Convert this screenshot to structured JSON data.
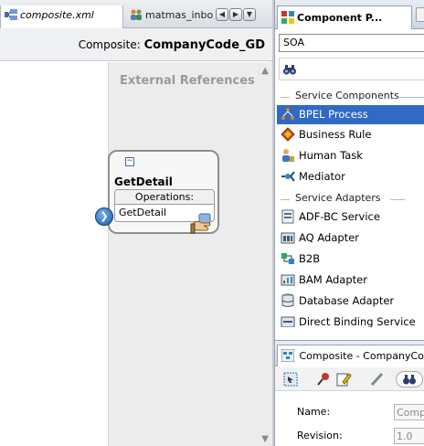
{
  "editor": {
    "tabs": [
      {
        "label": "composite.xml",
        "icon": "composite-icon"
      },
      {
        "label": "matmas_inbou",
        "icon": "mediator-people-icon"
      }
    ],
    "nav_buttons": [
      "◀",
      "▶",
      "▼"
    ],
    "composite_prefix": "Composite:",
    "composite_name": "CompanyCode_GD",
    "external_references_title": "External References",
    "service": {
      "name": "GetDetail",
      "operations_header": "Operations:",
      "operations": [
        "GetDetail"
      ],
      "collapse_symbol": "−",
      "arrow_symbol": "❯"
    }
  },
  "palette": {
    "title": "Component P...",
    "selected_category": "SOA",
    "groups": [
      {
        "label": "Service Components",
        "items": [
          {
            "label": "BPEL Process",
            "icon": "bpel-icon",
            "selected": true
          },
          {
            "label": "Business Rule",
            "icon": "business-rule-icon",
            "selected": false
          },
          {
            "label": "Human Task",
            "icon": "human-task-icon",
            "selected": false
          },
          {
            "label": "Mediator",
            "icon": "mediator-icon",
            "selected": false
          }
        ]
      },
      {
        "label": "Service Adapters",
        "items": [
          {
            "label": "ADF-BC Service",
            "icon": "adf-bc-icon",
            "selected": false
          },
          {
            "label": "AQ Adapter",
            "icon": "aq-adapter-icon",
            "selected": false
          },
          {
            "label": "B2B",
            "icon": "b2b-icon",
            "selected": false
          },
          {
            "label": "BAM Adapter",
            "icon": "bam-adapter-icon",
            "selected": false
          },
          {
            "label": "Database Adapter",
            "icon": "database-adapter-icon",
            "selected": false
          },
          {
            "label": "Direct Binding Service",
            "icon": "direct-binding-icon",
            "selected": false
          }
        ]
      }
    ]
  },
  "inspector": {
    "title": "Composite - CompanyCo",
    "fields": [
      {
        "label": "Name:",
        "value": "Comp"
      },
      {
        "label": "Revision:",
        "value": "1.0"
      }
    ]
  },
  "colors": {
    "selection": "#316ac5",
    "panel_header": "#cdd6e2",
    "external_refs_bg": "#ececec"
  }
}
